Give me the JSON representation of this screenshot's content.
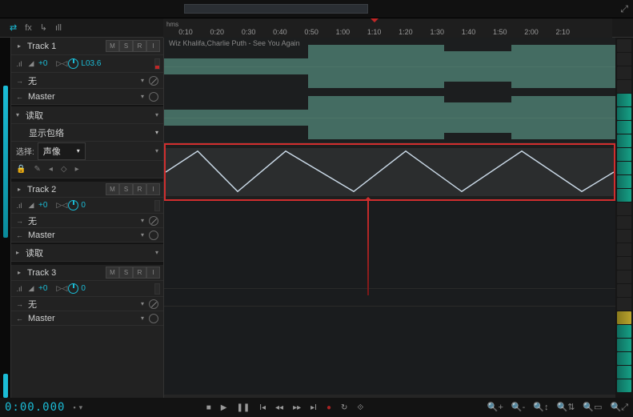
{
  "ruler": {
    "unit": "hms",
    "ticks": [
      "0:10",
      "0:20",
      "0:30",
      "0:40",
      "0:50",
      "1:00",
      "1:10",
      "1:20",
      "1:30",
      "1:40",
      "1:50",
      "2:00",
      "2:10"
    ]
  },
  "clip": {
    "title": "Wiz Khalifa,Charlie Puth - See You Again"
  },
  "tracks": [
    {
      "name": "Track 1",
      "mute": "M",
      "solo": "S",
      "rec": "R",
      "input": "I",
      "vol": "+0",
      "pan": "((○))",
      "link": "L03.6",
      "fx_none": "无",
      "bus": "Master"
    },
    {
      "name": "Track 2",
      "mute": "M",
      "solo": "S",
      "rec": "R",
      "input": "I",
      "vol": "+0",
      "pan": "((○))",
      "link": "0",
      "fx_none": "无",
      "bus": "Master"
    },
    {
      "name": "Track 3",
      "mute": "M",
      "solo": "S",
      "rec": "R",
      "input": "I",
      "vol": "+0",
      "pan": "((○))",
      "link": "0",
      "fx_none": "无",
      "bus": "Master"
    }
  ],
  "automation": {
    "read_label": "读取",
    "show_env_label": "显示包络",
    "select_label": "选择:",
    "select_value": "声像"
  },
  "transport": {
    "timecode": "0:00.000"
  },
  "colors": {
    "accent": "#1bbcd6",
    "alert": "#d12e2e",
    "wave": "#4b7a6f"
  }
}
